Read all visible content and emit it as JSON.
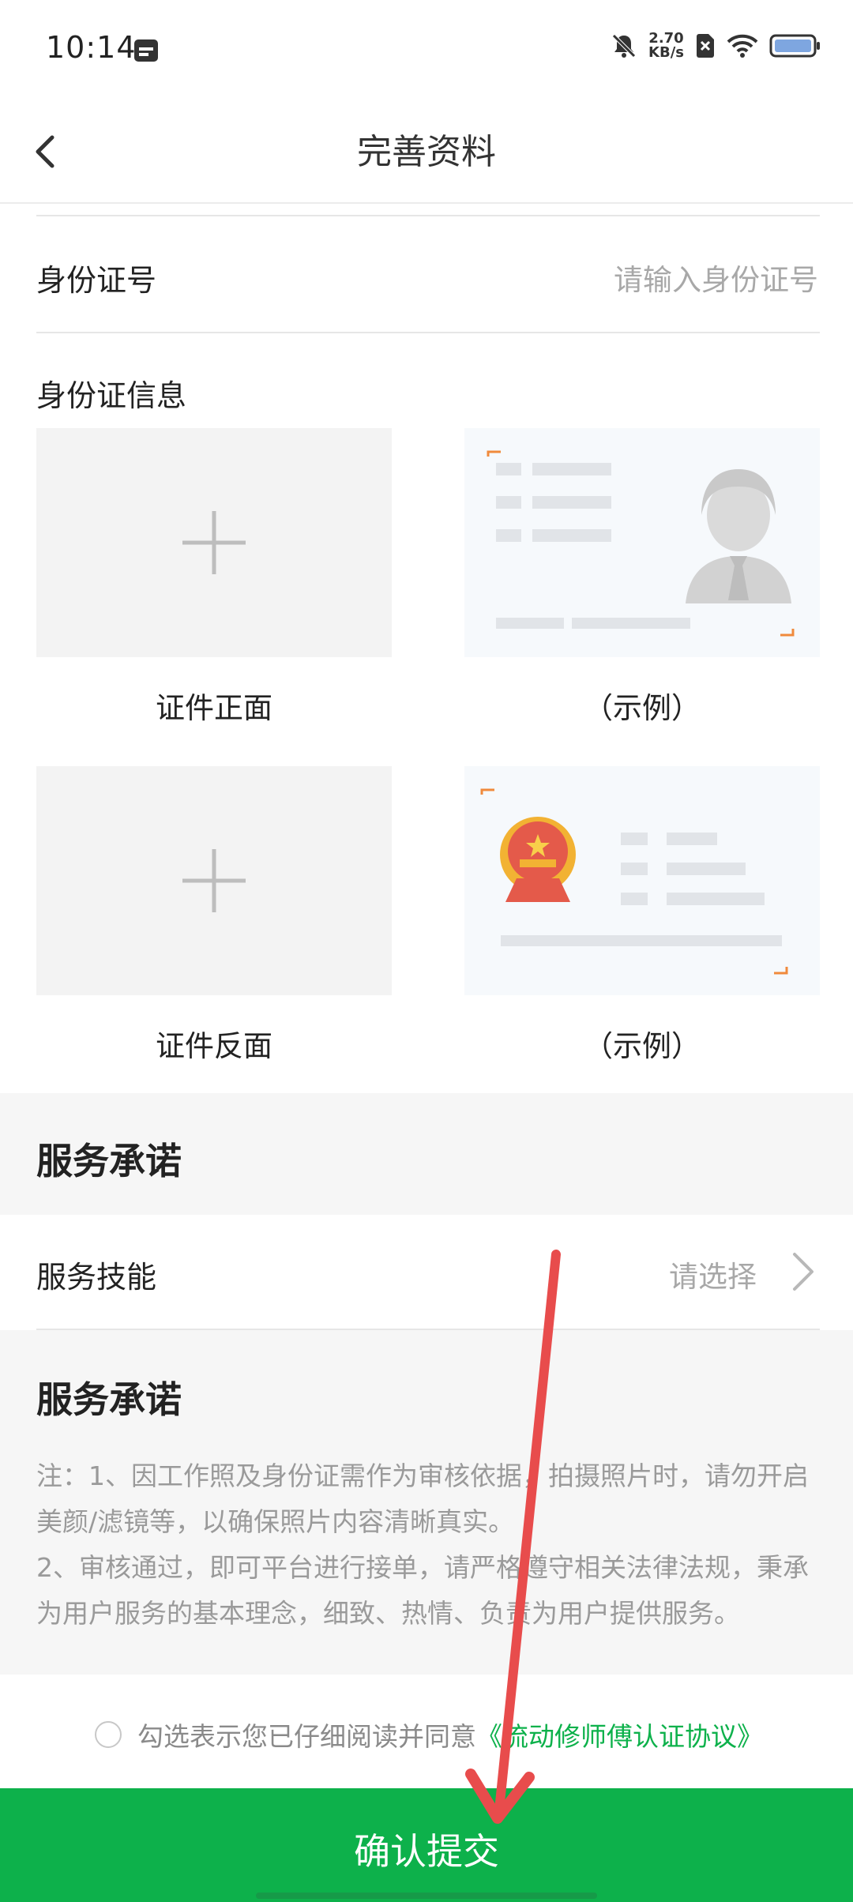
{
  "status_bar": {
    "time": "10:14",
    "net_speed_value": "2.70",
    "net_speed_unit": "KB/s",
    "icons": [
      "calendar-icon",
      "mute-icon",
      "no-sim-icon",
      "wifi-icon",
      "battery-icon"
    ]
  },
  "header": {
    "title": "完善资料",
    "back_icon": "chevron-left-icon"
  },
  "id_number": {
    "label": "身份证号",
    "placeholder": "请输入身份证号"
  },
  "id_info": {
    "title": "身份证信息",
    "front_caption": "证件正面",
    "front_example_caption": "（示例）",
    "back_caption": "证件反面",
    "back_example_caption": "（示例）"
  },
  "service_commitment_header": "服务承诺",
  "service_skill": {
    "label": "服务技能",
    "value": "请选择"
  },
  "commitment": {
    "title": "服务承诺",
    "note_line1": "注：1、因工作照及身份证需作为审核依据，拍摄照片时，请勿开启美颜/滤镜等，以确保照片内容清晰真实。",
    "note_line2": "2、审核通过，即可平台进行接单，请严格遵守相关法律法规，秉承为用户服务的基本理念，细致、热情、负责为用户提供服务。"
  },
  "agreement": {
    "text": "勾选表示您已仔细阅读并同意",
    "link": "《流动修师傅认证协议》"
  },
  "submit_button": "确认提交",
  "colors": {
    "accent": "#0db14b",
    "annotation_arrow": "#e84c4c"
  }
}
